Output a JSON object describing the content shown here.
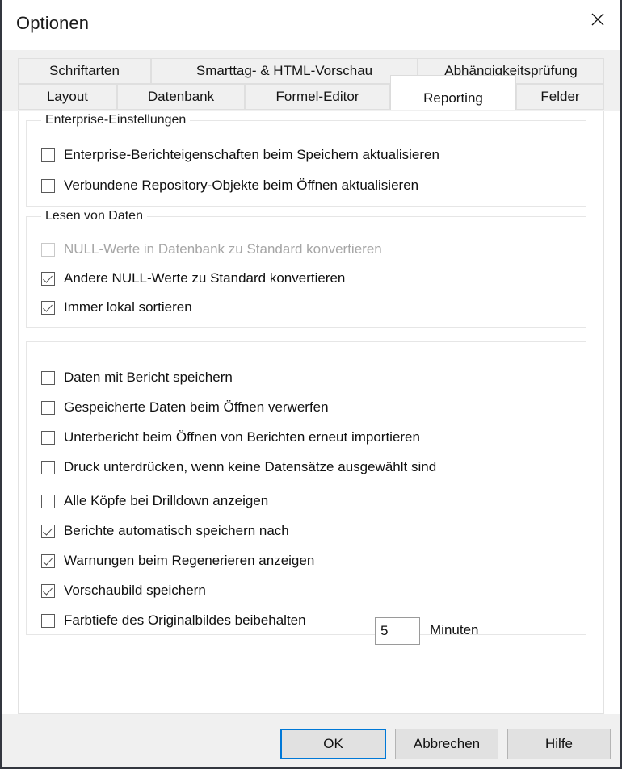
{
  "window": {
    "title": "Optionen",
    "close_icon": "close-icon"
  },
  "tabs": {
    "row1": [
      {
        "label": "Schriftarten",
        "active": false
      },
      {
        "label": "Smarttag- & HTML-Vorschau",
        "active": false
      },
      {
        "label": "Abhängigkeitsprüfung",
        "active": false
      }
    ],
    "row2": [
      {
        "label": "Layout",
        "active": false
      },
      {
        "label": "Datenbank",
        "active": false
      },
      {
        "label": "Formel-Editor",
        "active": false
      },
      {
        "label": "Reporting",
        "active": true
      },
      {
        "label": "Felder",
        "active": false
      }
    ]
  },
  "groups": {
    "enterprise": {
      "legend": "Enterprise-Einstellungen",
      "items": [
        {
          "label": "Enterprise-Berichteigenschaften beim Speichern aktualisieren",
          "checked": false,
          "disabled": false
        },
        {
          "label": "Verbundene Repository-Objekte beim Öffnen aktualisieren",
          "checked": false,
          "disabled": false
        }
      ]
    },
    "reading": {
      "legend": "Lesen von Daten",
      "items": [
        {
          "label": "NULL-Werte in Datenbank zu Standard konvertieren",
          "checked": false,
          "disabled": true
        },
        {
          "label": "Andere NULL-Werte zu Standard konvertieren",
          "checked": true,
          "disabled": false
        },
        {
          "label": "Immer lokal sortieren",
          "checked": true,
          "disabled": false
        }
      ]
    },
    "general": {
      "legend": "",
      "items": [
        {
          "label": "Daten mit Bericht speichern",
          "checked": false,
          "disabled": false
        },
        {
          "label": "Gespeicherte Daten beim Öffnen verwerfen",
          "checked": false,
          "disabled": false
        },
        {
          "label": "Unterbericht beim Öffnen von Berichten erneut importieren",
          "checked": false,
          "disabled": false
        },
        {
          "label": "Druck unterdrücken, wenn keine Datensätze ausgewählt sind",
          "checked": false,
          "disabled": false
        },
        {
          "label": "Alle Köpfe bei Drilldown anzeigen",
          "checked": false,
          "disabled": false
        },
        {
          "label": "Berichte automatisch speichern nach",
          "checked": true,
          "disabled": false
        },
        {
          "label": "Warnungen beim Regenerieren anzeigen",
          "checked": true,
          "disabled": false
        },
        {
          "label": "Vorschaubild speichern",
          "checked": true,
          "disabled": false
        },
        {
          "label": "Farbtiefe des Originalbildes beibehalten",
          "checked": false,
          "disabled": false
        }
      ]
    }
  },
  "autosave": {
    "minutes_value": "5",
    "minutes_unit": "Minuten"
  },
  "footer": {
    "ok_label": "OK",
    "cancel_label": "Abbrechen",
    "help_label": "Hilfe"
  },
  "colors": {
    "focus_blue": "#0078d7",
    "dialog_gray": "#f0f0f0",
    "text": "#101010",
    "disabled_text": "#a6a6a6"
  }
}
